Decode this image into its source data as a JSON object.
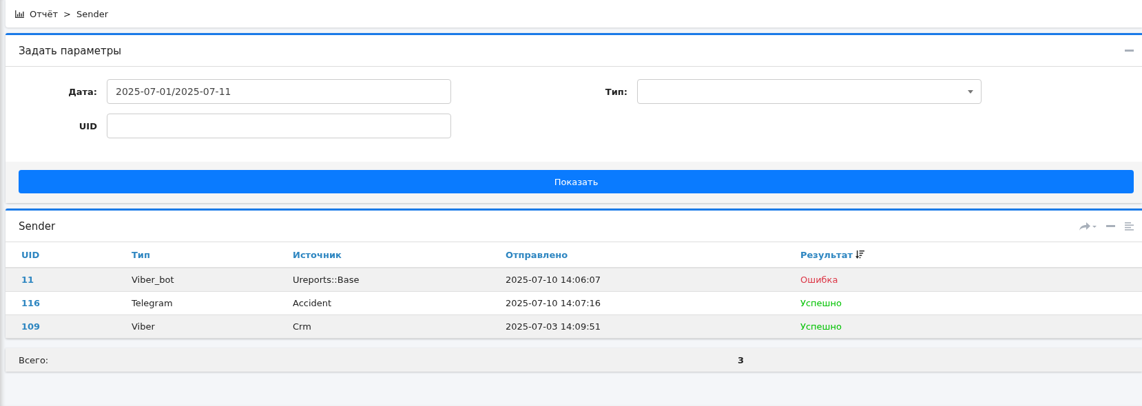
{
  "breadcrumb": {
    "items": [
      "Отчёт",
      "Sender"
    ],
    "separator": ">"
  },
  "params_panel": {
    "title": "Задать параметры",
    "fields": [
      {
        "label": "Дата:",
        "kind": "text",
        "value": "2025-07-01/2025-07-11"
      },
      {
        "label": "Тип:",
        "kind": "select"
      },
      {
        "label": "UID",
        "kind": "text"
      }
    ],
    "button": "Показать"
  },
  "results_panel": {
    "title": "Sender",
    "columns": [
      {
        "label": "UID",
        "sorted": false
      },
      {
        "label": "Тип",
        "sorted": false
      },
      {
        "label": "Источник",
        "sorted": false
      },
      {
        "label": "Отправлено",
        "sorted": false
      },
      {
        "label": "Результат",
        "sorted": true
      }
    ],
    "rows": [
      {
        "uid": "11",
        "type": "Viber_bot",
        "source": "Ureports::Base",
        "sent": "2025-07-10 14:06:07",
        "result": "Ошибка",
        "color": "#dc3545"
      },
      {
        "uid": "116",
        "type": "Telegram",
        "source": "Accident",
        "sent": "2025-07-10 14:07:16",
        "result": "Успешно",
        "color": "#00c200"
      },
      {
        "uid": "109",
        "type": "Viber",
        "source": "Crm",
        "sent": "2025-07-03 14:09:51",
        "result": "Успешно",
        "color": "#00c200"
      }
    ]
  },
  "total": {
    "label": "Всего:",
    "value": "3"
  }
}
